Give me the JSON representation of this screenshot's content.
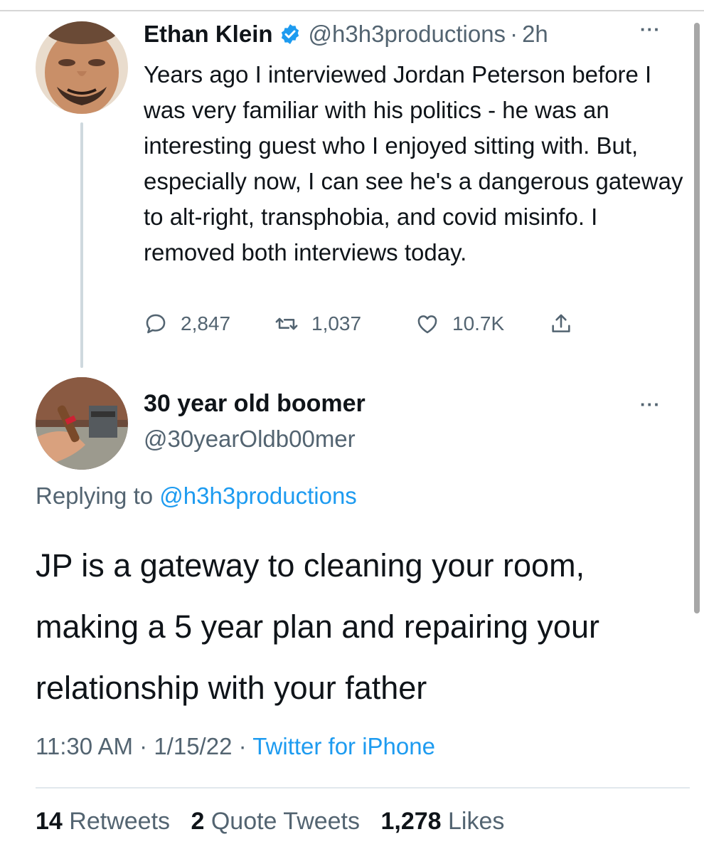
{
  "tweet1": {
    "display_name": "Ethan Klein",
    "handle": "@h3h3productions",
    "separator": "·",
    "time": "2h",
    "text": "Years ago I interviewed Jordan Peterson before I was very familiar with his politics - he was an interesting guest who I enjoyed sitting with. But, especially now, I can see he's a dangerous gateway to alt-right, transphobia, and covid misinfo. I removed both interviews today.",
    "replies": "2,847",
    "retweets": "1,037",
    "likes": "10.7K",
    "more": "···",
    "icons": [
      "verified-badge-icon",
      "reply-icon",
      "retweet-icon",
      "like-icon",
      "share-icon"
    ]
  },
  "tweet2": {
    "display_name": "30 year old boomer",
    "handle": "@30yearOldb00mer",
    "more": "···",
    "replying_prefix": "Replying to",
    "replying_handle": "@h3h3productions",
    "text": "JP is a gateway to cleaning your room, making a 5 year plan and repairing your relationship with your father",
    "time": "11:30 AM",
    "date": "1/15/22",
    "separator": "·",
    "source": "Twitter for iPhone",
    "retweets_count": "14",
    "retweets_label": "Retweets",
    "quotes_count": "2",
    "quotes_label": "Quote Tweets",
    "likes_count": "1,278",
    "likes_label": "Likes"
  },
  "colors": {
    "link": "#1d9bf0",
    "muted": "#536471",
    "text": "#0f1419",
    "verified": "#1d9bf0"
  }
}
